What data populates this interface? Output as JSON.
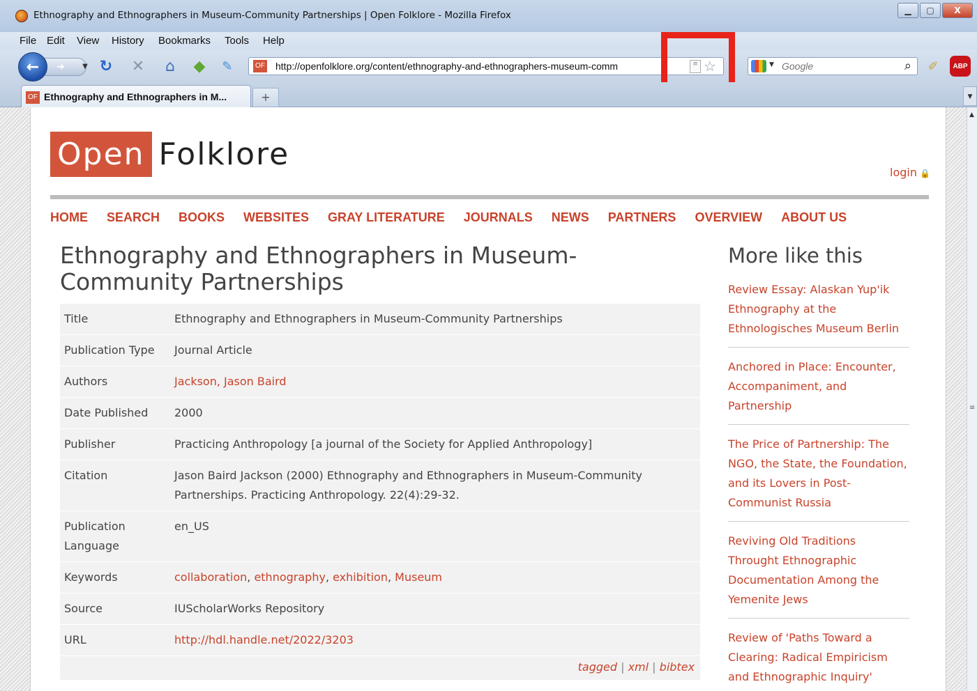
{
  "window": {
    "title": "Ethnography and Ethnographers in Museum-Community Partnerships | Open Folklore - Mozilla Firefox",
    "min_label": "▁",
    "max_label": "▢",
    "close_label": "X"
  },
  "menu": [
    "File",
    "Edit",
    "View",
    "History",
    "Bookmarks",
    "Tools",
    "Help"
  ],
  "toolbar": {
    "url": "http://openfolklore.org/content/ethnography-and-ethnographers-museum-comm",
    "site_icon": "OF",
    "search_placeholder": "Google",
    "abp_label": "ABP"
  },
  "tabs": [
    {
      "label": "Ethnography and Ethnographers in M...",
      "icon": "OF"
    }
  ],
  "new_tab_label": "+",
  "site": {
    "logo_open": "Open",
    "logo_folklore": "Folklore",
    "login": "login",
    "nav": [
      "HOME",
      "SEARCH",
      "BOOKS",
      "WEBSITES",
      "GRAY LITERATURE",
      "JOURNALS",
      "NEWS",
      "PARTNERS",
      "OVERVIEW",
      "ABOUT US"
    ]
  },
  "page": {
    "title": "Ethnography and Ethnographers in Museum-Community Partnerships",
    "fields": {
      "title_label": "Title",
      "title_value": "Ethnography and Ethnographers in Museum-Community Partnerships",
      "type_label": "Publication Type",
      "type_value": "Journal Article",
      "authors_label": "Authors",
      "authors_value": "Jackson, Jason Baird",
      "date_label": "Date Published",
      "date_value": "2000",
      "publisher_label": "Publisher",
      "publisher_value": "Practicing Anthropology [a journal of the Society for Applied Anthropology]",
      "citation_label": "Citation",
      "citation_value": "Jason Baird Jackson (2000) Ethnography and Ethnographers in Museum-Community Partnerships. Practicing Anthropology. 22(4):29-32.",
      "language_label": "Publication Language",
      "language_value": "en_US",
      "keywords_label": "Keywords",
      "keywords": [
        "collaboration",
        "ethnography",
        "exhibition",
        "Museum"
      ],
      "source_label": "Source",
      "source_value": "IUScholarWorks Repository",
      "url_label": "URL",
      "url_value": "http://hdl.handle.net/2022/3203"
    },
    "export_links": [
      "tagged",
      "xml",
      "bibtex"
    ]
  },
  "sidebar": {
    "heading": "More like this",
    "items": [
      "Review Essay: Alaskan Yup'ik Ethnography at the Ethnologisches Museum Berlin",
      "Anchored in Place: Encounter, Accompaniment, and Partnership",
      "The Price of Partnership: The NGO, the State, the Foundation, and its Lovers in Post-Communist Russia",
      "Reviving Old Traditions Throught Ethnographic Documentation Among the Yemenite Jews",
      "Review of 'Paths Toward a Clearing: Radical Empiricism and Ethnographic Inquiry' (Jackson)"
    ]
  },
  "colors": {
    "accent": "#c8432b",
    "logo_bg": "#d2553b",
    "highlight_box": "#e8231a"
  }
}
